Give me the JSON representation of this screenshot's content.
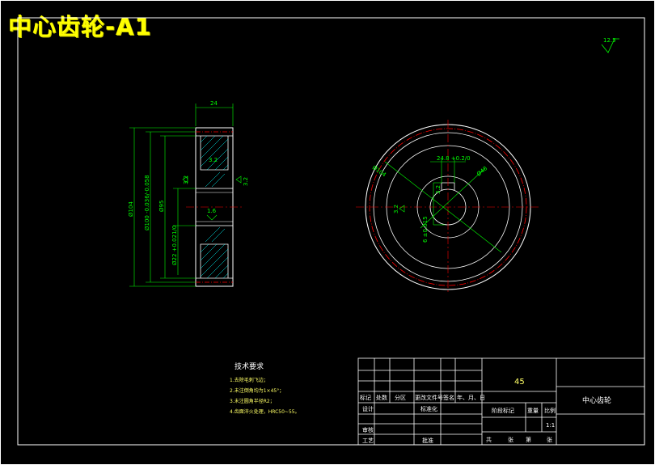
{
  "title": "中心齿轮-A1",
  "roughness_corner": "12.5",
  "dimensions": {
    "width": "24",
    "d_tip": "Ø104",
    "d_root": "Ø100 -0.036/-0.058",
    "d_hub": "Ø95",
    "d_bore": "Ø22 +0.021/0",
    "rough_1": "3.2",
    "rough_2": "3.2",
    "rough_3": "1.6",
    "rough_4": "3.2",
    "keyway_width": "24.8 +0.2/0",
    "keyway_depth": "6 ±0.015",
    "circle_d": "Ø48",
    "side_rough": "3.2",
    "outer_label": "Ø104"
  },
  "tech_requirements": {
    "heading": "技术要求",
    "items": [
      "1.去除毛刺飞边；",
      "2.未注倒角均为1×45°；",
      "3.未注圆角半径R2；",
      "4.齿面淬火处理，HRC50~55。"
    ]
  },
  "title_block": {
    "material": "45",
    "part_name": "中心齿轮",
    "row_labels": [
      "标记",
      "处数",
      "分区",
      "更改文件号",
      "签名",
      "年、月、日"
    ],
    "designer": "设计",
    "standardize": "标准化",
    "check": "审核",
    "process": "工艺",
    "approve": "批准",
    "stage_mark": "阶段标记",
    "weight": "重量",
    "scale": "比例",
    "scale_value": "1:1",
    "sheet_total": "共",
    "sheet_word1": "张",
    "sheet_no": "第",
    "sheet_word2": "张"
  },
  "colors": {
    "background": "#000000",
    "frame": "#ffffff",
    "dimension": "#00ff00",
    "center_line": "#ff0000",
    "hatch": "#00ffff",
    "title": "#ffff00"
  }
}
